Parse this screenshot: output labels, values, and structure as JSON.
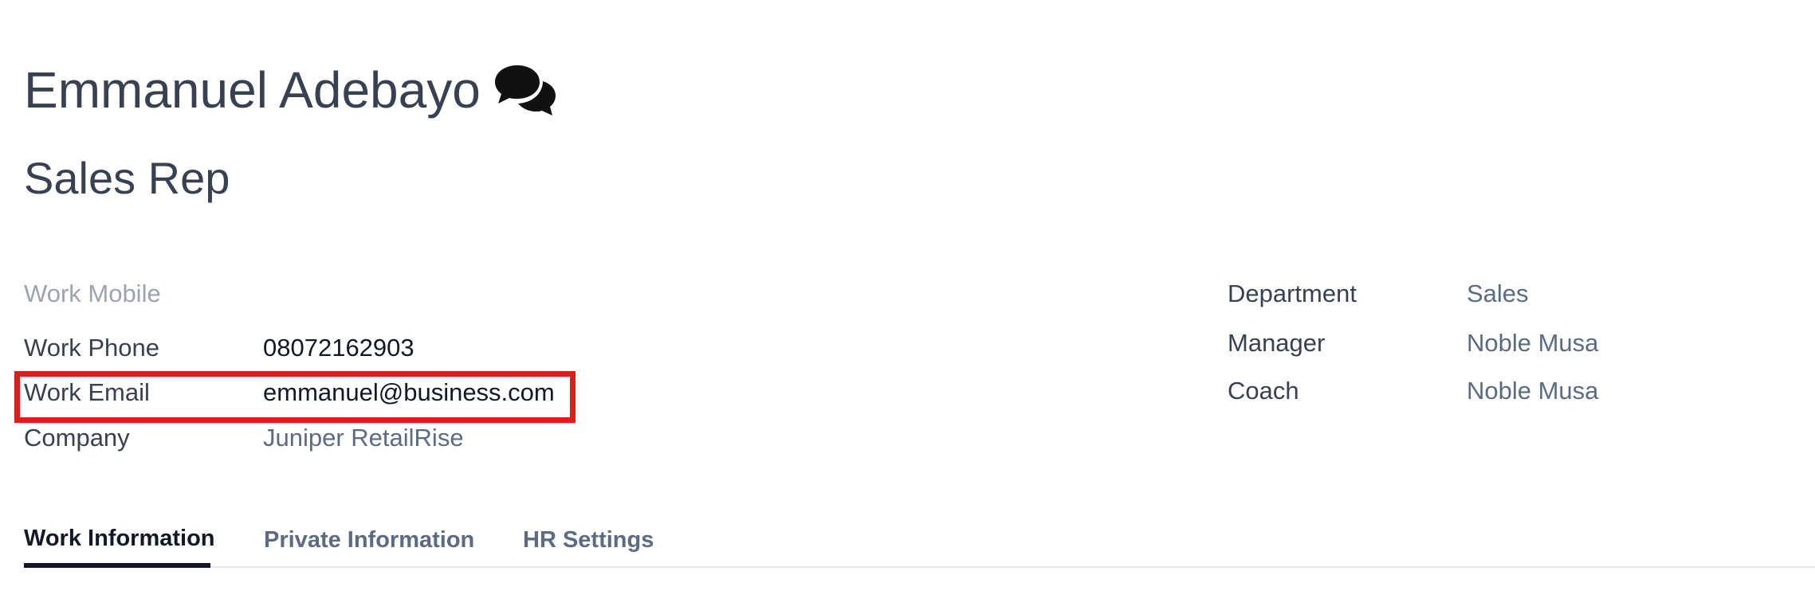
{
  "employee": {
    "name": "Emmanuel Adebayo",
    "job_title": "Sales Rep"
  },
  "left_fields": {
    "work_mobile_label": "Work Mobile",
    "work_mobile_value": "",
    "work_phone_label": "Work Phone",
    "work_phone_value": "08072162903",
    "work_email_label": "Work Email",
    "work_email_value": "emmanuel@business.com",
    "company_label": "Company",
    "company_value": "Juniper RetailRise"
  },
  "right_fields": {
    "department_label": "Department",
    "department_value": "Sales",
    "manager_label": "Manager",
    "manager_value": "Noble Musa",
    "coach_label": "Coach",
    "coach_value": "Noble Musa"
  },
  "tabs": [
    {
      "label": "Work Information",
      "active": true
    },
    {
      "label": "Private Information",
      "active": false
    },
    {
      "label": "HR Settings",
      "active": false
    }
  ],
  "icons": {
    "chat": "chat-bubbles-icon"
  },
  "colors": {
    "highlight": "#e01b1b",
    "text_primary": "#374151",
    "text_muted": "#9ca3af",
    "link": "#5b6b82"
  }
}
